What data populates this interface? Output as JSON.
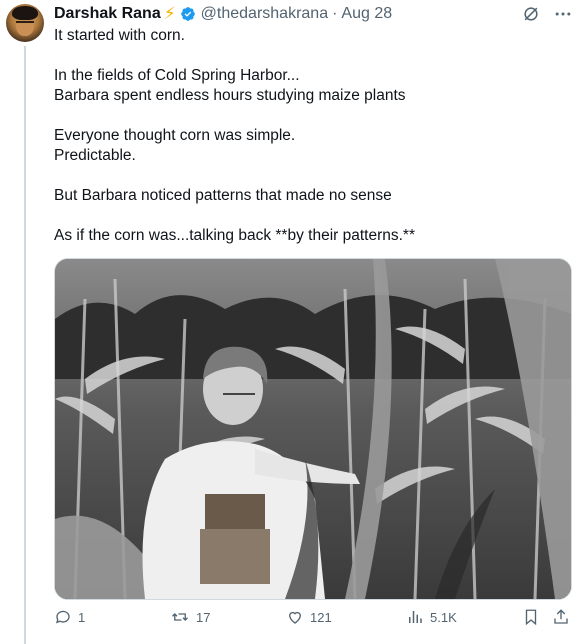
{
  "tweet": {
    "author_name": "Darshak Rana",
    "author_emoji": "⚡",
    "handle": "@thedarshakrana",
    "separator": "·",
    "date": "Aug 28",
    "text_lines": [
      "It started with corn.",
      "",
      "In the fields of Cold Spring Harbor...",
      "Barbara spent endless hours studying maize plants",
      "",
      "Everyone thought corn was simple.",
      "Predictable.",
      "",
      "But Barbara noticed patterns that made no sense",
      "",
      "As if the corn was...talking back **by their patterns.**"
    ]
  },
  "actions": {
    "replies": "1",
    "reposts": "17",
    "likes": "121",
    "views": "5.1K"
  },
  "colors": {
    "text": "#0f1419",
    "muted": "#536471",
    "verified": "#1d9bf0",
    "bolt": "#f4b400",
    "border": "#cfd9de"
  },
  "icons": {
    "verified": "verified-badge-icon",
    "grok": "grok-icon",
    "more": "more-icon",
    "reply": "reply-icon",
    "repost": "repost-icon",
    "like": "like-icon",
    "views": "views-icon",
    "bookmark": "bookmark-icon",
    "share": "share-icon"
  }
}
